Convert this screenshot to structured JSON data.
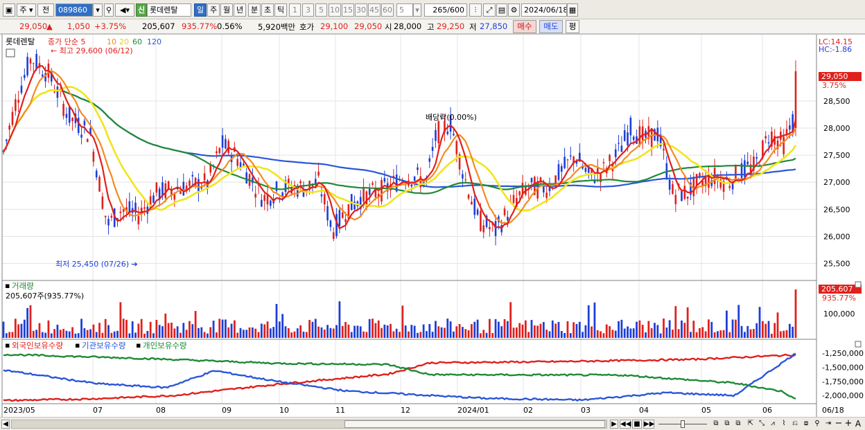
{
  "toolbar": {
    "period_main": "주",
    "prev": "전",
    "code": "089860",
    "credit": "신",
    "name": "롯데렌탈",
    "periods": [
      "일",
      "주",
      "월",
      "년",
      "분",
      "초",
      "틱"
    ],
    "intervals": [
      "1",
      "3",
      "5",
      "10",
      "15",
      "30",
      "45",
      "60"
    ],
    "interval_value": "5",
    "count": "265",
    "count_total": "/600",
    "date": "2024/06/18"
  },
  "quote": {
    "price": "29,050",
    "arrow": "▲",
    "change": "1,050",
    "change_pct": "+3.75%",
    "volume": "205,607",
    "volume_ratio": "935.77%",
    "turnover": "0.56%",
    "amount": "5,920백만",
    "hoga_label": "호가",
    "ask": "29,100",
    "bid": "29,050",
    "open_label": "시",
    "open": "28,000",
    "high_label": "고",
    "high": "29,250",
    "low_label": "저",
    "low": "27,850",
    "buy_label": "매수",
    "sell_label": "매도",
    "eval_label": "평"
  },
  "price_panel": {
    "name": "롯데렌탈",
    "ma_title": "종가 단순",
    "ma_periods": [
      "5",
      "10",
      "20",
      "60",
      "120"
    ],
    "ma_colors": [
      "#e0201c",
      "#f58a1f",
      "#f2e51b",
      "#1e8a36",
      "#2a56d8"
    ],
    "high_label": "최고 29,600 (06/12)",
    "low_label": "최저 25,450 (07/26)",
    "alloc_label": "배당락(0.00%)",
    "lc_label": "LC:14.15",
    "hc_label": "HC:-1.86",
    "current_price_label": "29,050",
    "current_pct_label": "3.75%",
    "y_ticks": [
      25500,
      26000,
      26500,
      27000,
      27500,
      28000,
      28500
    ],
    "y_tick_labels": [
      "25,500",
      "26,000",
      "26,500",
      "27,000",
      "27,500",
      "28,000",
      "28,500"
    ],
    "y_range": [
      25250,
      29650
    ]
  },
  "volume_panel": {
    "title": "거래량",
    "value_label": "205,607주(935.77%)",
    "y_tick_label": "100,000",
    "current_label": "205,607",
    "current_pct_label": "935.77%"
  },
  "holding_panel": {
    "labels": [
      "외국인보유수량",
      "기관보유수량",
      "개인보유수량"
    ],
    "colors": [
      "#e0201c",
      "#2a56d8",
      "#1e8a36"
    ],
    "y_tick_labels": [
      "-1,250,000",
      "-1,500,000",
      "-1,750,000",
      "-2,000,000"
    ]
  },
  "x_axis": {
    "labels": [
      "2023/05",
      "07",
      "08",
      "09",
      "10",
      "11",
      "12",
      "2024/01",
      "02",
      "03",
      "04",
      "05",
      "06"
    ],
    "right_label": "06/18"
  },
  "chart_data": {
    "type": "line",
    "x_range": [
      "2023/05",
      "2024/06/18"
    ],
    "series": [
      {
        "name": "5",
        "key_points": [
          [
            0,
            27300
          ],
          [
            25,
            28600
          ],
          [
            45,
            29300
          ],
          [
            70,
            29000
          ],
          [
            100,
            28200
          ],
          [
            130,
            27900
          ],
          [
            155,
            26200
          ],
          [
            175,
            26500
          ],
          [
            200,
            26400
          ],
          [
            225,
            26800
          ],
          [
            260,
            26900
          ],
          [
            300,
            27000
          ],
          [
            320,
            27700
          ],
          [
            340,
            27500
          ],
          [
            360,
            27100
          ],
          [
            380,
            26700
          ],
          [
            410,
            26900
          ],
          [
            440,
            26900
          ],
          [
            460,
            27000
          ],
          [
            480,
            26100
          ],
          [
            500,
            26500
          ],
          [
            520,
            26700
          ],
          [
            540,
            26800
          ],
          [
            560,
            26900
          ],
          [
            580,
            27100
          ],
          [
            600,
            27100
          ],
          [
            615,
            27000
          ],
          [
            630,
            27900
          ],
          [
            650,
            28100
          ],
          [
            670,
            27100
          ],
          [
            690,
            26300
          ],
          [
            715,
            26100
          ],
          [
            740,
            26600
          ],
          [
            760,
            26900
          ],
          [
            790,
            26900
          ],
          [
            810,
            27200
          ],
          [
            830,
            27500
          ],
          [
            850,
            27100
          ],
          [
            870,
            27200
          ],
          [
            890,
            27500
          ],
          [
            910,
            28000
          ],
          [
            930,
            27800
          ],
          [
            950,
            27900
          ],
          [
            970,
            26800
          ],
          [
            990,
            26800
          ],
          [
            1010,
            27000
          ],
          [
            1030,
            27100
          ],
          [
            1050,
            27000
          ],
          [
            1070,
            27200
          ],
          [
            1090,
            27300
          ],
          [
            1110,
            27900
          ],
          [
            1130,
            27700
          ],
          [
            1146,
            28200
          ]
        ]
      },
      {
        "name": "10"
      },
      {
        "name": "20"
      },
      {
        "name": "60"
      },
      {
        "name": "120"
      }
    ],
    "holdings": [
      {
        "name": "외국인보유수량",
        "trend": "rising",
        "start": -2100000,
        "end": -1270000
      },
      {
        "name": "기관보유수량",
        "trend": "falling then rising",
        "start": -1530000,
        "end": -1280000
      },
      {
        "name": "개인보유수량",
        "trend": "falling",
        "start": -1280000,
        "end": -2050000
      }
    ],
    "volume_last": 205607
  },
  "scrollbar": {
    "buttons": [
      "◀",
      "▶",
      "◀◀",
      "■",
      "▶▶",
      "−",
      "+",
      "A"
    ]
  }
}
